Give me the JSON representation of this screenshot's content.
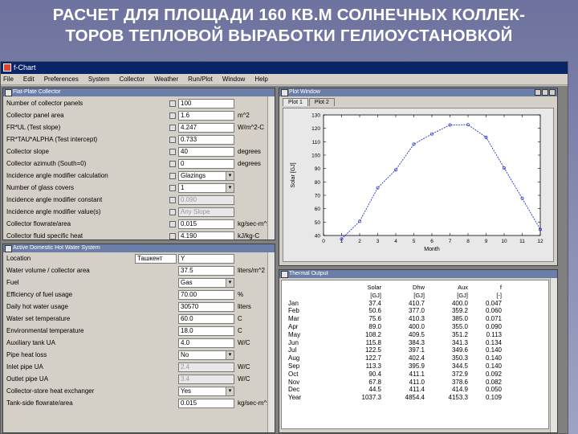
{
  "slide": {
    "title_line1": "РАСЧЕТ ДЛЯ ПЛОЩАДИ 160 КВ.М СОЛНЕЧНЫХ КОЛЛЕК-",
    "title_line2": "ТОРОВ ТЕПЛОВОЙ ВЫРАБОТКИ ГЕЛИОУСТАНОВКОЙ"
  },
  "app": {
    "title": "f-Chart",
    "menu": [
      "File",
      "Edit",
      "Preferences",
      "System",
      "Collector",
      "Weather",
      "Run/Plot",
      "Window",
      "Help"
    ]
  },
  "collector": {
    "title": "Flat-Plate Collector",
    "rows": [
      {
        "label": "Number of collector panels",
        "value": "100",
        "unit": "",
        "kind": "text"
      },
      {
        "label": "Collector panel area",
        "value": "1.6",
        "unit": "m^2",
        "kind": "text"
      },
      {
        "label": "FR*UL (Test slope)",
        "value": "4.247",
        "unit": "W/m^2-C",
        "kind": "text"
      },
      {
        "label": "FR*TAU*ALPHA (Test intercept)",
        "value": "0.733",
        "unit": "",
        "kind": "text"
      },
      {
        "label": "Collector slope",
        "value": "40",
        "unit": "degrees",
        "kind": "text"
      },
      {
        "label": "Collector azimuth (South=0)",
        "value": "0",
        "unit": "degrees",
        "kind": "text"
      },
      {
        "label": "Incidence angle modifier calculation",
        "value": "Glazings",
        "unit": "",
        "kind": "select"
      },
      {
        "label": "Number of glass covers",
        "value": "1",
        "unit": "",
        "kind": "select"
      },
      {
        "label": "Incidence angle modifier constant",
        "value": "0.090",
        "unit": "",
        "kind": "disabled"
      },
      {
        "label": "Incidence angle modifier value(s)",
        "value": "Any Slope",
        "unit": "",
        "kind": "disabled"
      },
      {
        "label": "Collector flowrate/area",
        "value": "0.015",
        "unit": "kg/sec-m^2",
        "kind": "text"
      },
      {
        "label": "Collector fluid specific heat",
        "value": "4.190",
        "unit": "kJ/kg-C",
        "kind": "text"
      }
    ]
  },
  "dhw": {
    "title": "Active Domestic Hot Water System",
    "location_label": "Location",
    "location_value": "Ташкент",
    "location_extra": "Y",
    "rows": [
      {
        "label": "Water volume / collector area",
        "value": "37.5",
        "unit": "liters/m^2",
        "kind": "text"
      },
      {
        "label": "Fuel",
        "value": "Gas",
        "unit": "",
        "kind": "select"
      },
      {
        "label": "Efficiency of fuel usage",
        "value": "70.00",
        "unit": "%",
        "kind": "text"
      },
      {
        "label": "Daily hot water usage",
        "value": "30570",
        "unit": "liters",
        "kind": "text"
      },
      {
        "label": "Water set temperature",
        "value": "60.0",
        "unit": "C",
        "kind": "text"
      },
      {
        "label": "Environmental temperature",
        "value": "18.0",
        "unit": "C",
        "kind": "text"
      },
      {
        "label": "Auxiliary tank UA",
        "value": "4.0",
        "unit": "W/C",
        "kind": "text"
      },
      {
        "label": "Pipe heat loss",
        "value": "No",
        "unit": "",
        "kind": "select"
      },
      {
        "label": "Inlet pipe UA",
        "value": "2.4",
        "unit": "W/C",
        "kind": "disabled"
      },
      {
        "label": "Outlet pipe UA",
        "value": "3.4",
        "unit": "W/C",
        "kind": "disabled"
      },
      {
        "label": "Collector-store heat exchanger",
        "value": "Yes",
        "unit": "",
        "kind": "select"
      },
      {
        "label": "Tank-side flowrate/area",
        "value": "0.015",
        "unit": "kg/sec-m^2",
        "kind": "text"
      }
    ]
  },
  "plot_window": {
    "title": "Plot Window",
    "tabs": [
      "Plot 1",
      "Plot 2"
    ]
  },
  "chart_data": {
    "type": "line",
    "title": "",
    "xlabel": "Month",
    "ylabel": "Solar [GJ]",
    "x": [
      1,
      2,
      3,
      4,
      5,
      6,
      7,
      8,
      9,
      10,
      11,
      12
    ],
    "series": [
      {
        "values": [
          37.4,
          50.6,
          75.6,
          89.0,
          108.2,
          115.8,
          122.5,
          122.7,
          113.3,
          90.4,
          67.8,
          44.5
        ]
      }
    ],
    "xlim": [
      0,
      12
    ],
    "ylim": [
      40,
      130
    ],
    "yticks": [
      40,
      50,
      60,
      70,
      80,
      90,
      100,
      110,
      120,
      130
    ],
    "xticks": [
      0,
      1,
      2,
      3,
      4,
      5,
      6,
      7,
      8,
      9,
      10,
      11,
      12
    ],
    "grid": false
  },
  "thermal": {
    "title": "Thermal Output",
    "headers": [
      "",
      "Solar",
      "Dhw",
      "Aux",
      "f"
    ],
    "units": [
      "",
      "[GJ]",
      "[GJ]",
      "[GJ]",
      "[-]"
    ],
    "rows": [
      [
        "Jan",
        "37.4",
        "410.7",
        "400.0",
        "0.047"
      ],
      [
        "Feb",
        "50.6",
        "377.0",
        "359.2",
        "0.060"
      ],
      [
        "Mar",
        "75.6",
        "410.3",
        "385.0",
        "0.071"
      ],
      [
        "Apr",
        "89.0",
        "400.0",
        "355.0",
        "0.090"
      ],
      [
        "May",
        "108.2",
        "409.5",
        "351.2",
        "0.113"
      ],
      [
        "Jun",
        "115.8",
        "384.3",
        "341.3",
        "0.134"
      ],
      [
        "Jul",
        "122.5",
        "397.1",
        "349.6",
        "0.140"
      ],
      [
        "Aug",
        "122.7",
        "402.4",
        "350.3",
        "0.140"
      ],
      [
        "Sep",
        "113.3",
        "395.9",
        "344.5",
        "0.140"
      ],
      [
        "Oct",
        "90.4",
        "411.1",
        "372.9",
        "0.092"
      ],
      [
        "Nov",
        "67.8",
        "411.0",
        "378.6",
        "0.082"
      ],
      [
        "Dec",
        "44.5",
        "411.4",
        "414.9",
        "0.050"
      ],
      [
        "Year",
        "1037.3",
        "4854.4",
        "4153.3",
        "0.109"
      ]
    ]
  }
}
